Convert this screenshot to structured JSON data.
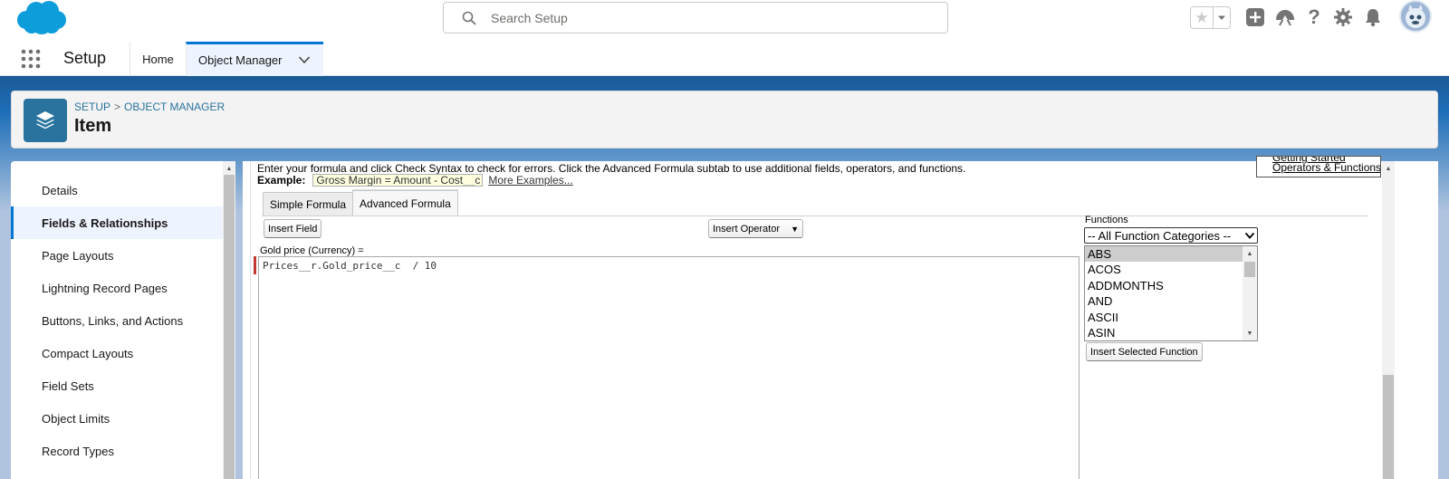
{
  "header": {
    "search_placeholder": "Search Setup",
    "icons": [
      "salesforce-cloud-logo",
      "search-icon",
      "star-icon",
      "chevron-down-icon",
      "plus-icon",
      "trailhead-icon",
      "help-icon",
      "gear-icon",
      "bell-icon",
      "avatar"
    ]
  },
  "nav": {
    "app_name": "Setup",
    "tabs": [
      {
        "label": "Home"
      },
      {
        "label": "Object Manager"
      }
    ]
  },
  "page_header": {
    "breadcrumb": [
      "SETUP",
      "OBJECT MANAGER"
    ],
    "breadcrumb_separator": ">",
    "title": "Item"
  },
  "sidebar": {
    "items": [
      {
        "label": "Details"
      },
      {
        "label": "Fields & Relationships"
      },
      {
        "label": "Page Layouts"
      },
      {
        "label": "Lightning Record Pages"
      },
      {
        "label": "Buttons, Links, and Actions"
      },
      {
        "label": "Compact Layouts"
      },
      {
        "label": "Field Sets"
      },
      {
        "label": "Object Limits"
      },
      {
        "label": "Record Types"
      }
    ],
    "active_label": "Fields & Relationships"
  },
  "editor": {
    "instructions": "Enter your formula and click Check Syntax to check for errors. Click the Advanced Formula subtab to use additional fields, operators, and functions.",
    "example_label": "Example:",
    "example_value": "Gross Margin = Amount - Cost__c",
    "more_examples": "More Examples...",
    "help_links": [
      "Getting Started",
      "Operators & Functions"
    ],
    "tabs": [
      {
        "label": "Simple Formula"
      },
      {
        "label": "Advanced Formula"
      }
    ],
    "insert_field_label": "Insert Field",
    "insert_operator_label": "Insert Operator",
    "formula_label": "Gold price (Currency) =",
    "formula_value": "Prices__r.Gold_price__c  / 10",
    "functions_label": "Functions",
    "function_category": "-- All Function Categories --",
    "functions": [
      "ABS",
      "ACOS",
      "ADDMONTHS",
      "AND",
      "ASCII",
      "ASIN"
    ],
    "selected_function": "ABS",
    "insert_function_label": "Insert Selected Function"
  },
  "colors": {
    "brand_blue": "#0176d3",
    "object_icon": "#2a739e",
    "backdrop": "#1b5a96",
    "required": "#c23934"
  }
}
